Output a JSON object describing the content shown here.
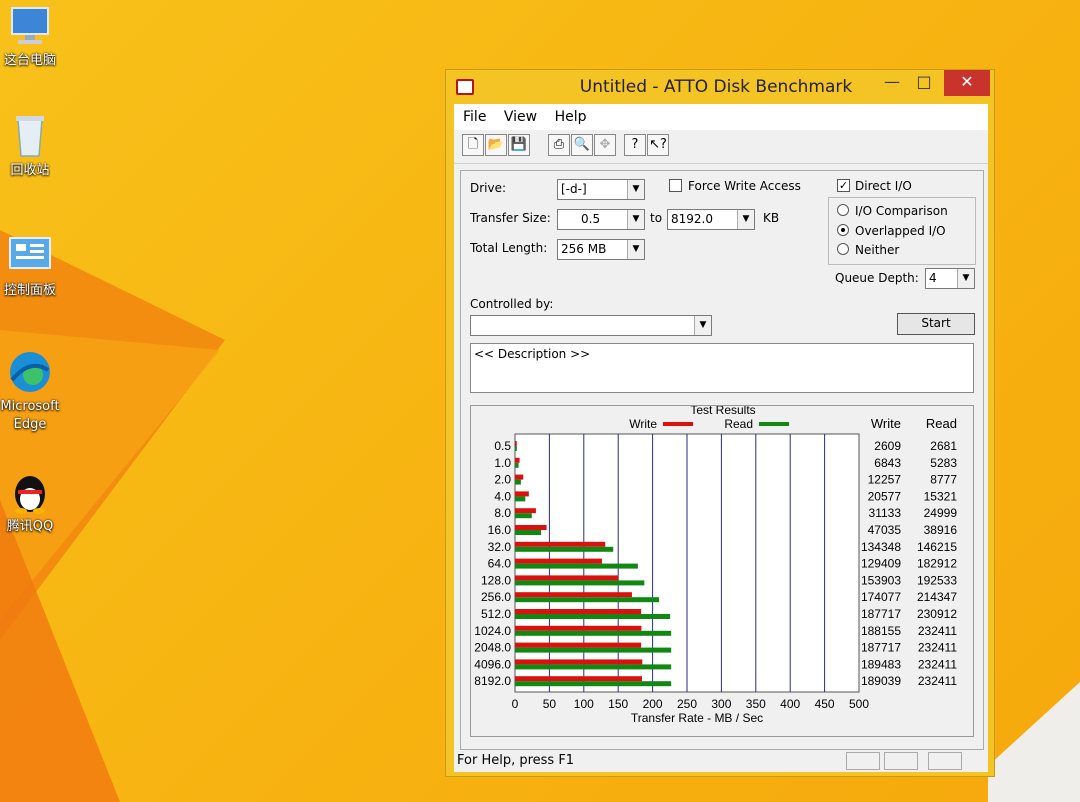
{
  "desktop": {
    "icons": [
      {
        "label": "这台电脑"
      },
      {
        "label": "回收站"
      },
      {
        "label": "控制面板"
      },
      {
        "label": "Microsoft Edge"
      },
      {
        "label": "腾讯QQ"
      }
    ]
  },
  "window": {
    "title": "Untitled - ATTO Disk Benchmark",
    "menu": [
      "File",
      "View",
      "Help"
    ],
    "toolbar_icons": [
      "new-icon",
      "open-icon",
      "save-icon",
      "print-icon",
      "print-preview-icon",
      "move-icon",
      "help-icon",
      "context-help-icon"
    ],
    "form": {
      "drive_label": "Drive:",
      "drive_value": "[-d-]",
      "transfer_label": "Transfer Size:",
      "transfer_from": "0.5",
      "transfer_to_label": "to",
      "transfer_to": "8192.0",
      "transfer_unit": "KB",
      "total_label": "Total Length:",
      "total_value": "256 MB",
      "force_write_label": "Force Write Access",
      "direct_io_label": "Direct I/O",
      "io_comparison_label": "I/O Comparison",
      "overlapped_label": "Overlapped I/O",
      "neither_label": "Neither",
      "queue_label": "Queue Depth:",
      "queue_value": "4",
      "controlled_label": "Controlled by:",
      "controlled_value": "",
      "start_label": "Start",
      "description": "<< Description >>"
    },
    "status": "For Help, press F1"
  },
  "chart_data": {
    "type": "bar",
    "title": "Test Results",
    "xlabel": "Transfer Rate - MB / Sec",
    "xlim": [
      0,
      500
    ],
    "x_ticks": [
      "0",
      "50",
      "100",
      "150",
      "200",
      "250",
      "300",
      "350",
      "400",
      "450",
      "500"
    ],
    "legend": {
      "write": "Write",
      "read": "Read"
    },
    "colors": {
      "write": "#dd1010",
      "read": "#118811"
    },
    "col_write": "Write",
    "col_read": "Read",
    "categories": [
      "0.5",
      "1.0",
      "2.0",
      "4.0",
      "8.0",
      "16.0",
      "32.0",
      "64.0",
      "128.0",
      "256.0",
      "512.0",
      "1024.0",
      "2048.0",
      "4096.0",
      "8192.0"
    ],
    "series": [
      {
        "name": "Write",
        "values": [
          2609,
          6843,
          12257,
          20577,
          31133,
          47035,
          134348,
          129409,
          153903,
          174077,
          187717,
          188155,
          187717,
          189483,
          189039
        ]
      },
      {
        "name": "Read",
        "values": [
          2681,
          5283,
          8777,
          15321,
          24999,
          38916,
          146215,
          182912,
          192533,
          214347,
          230912,
          232411,
          232411,
          232411,
          232411
        ]
      }
    ]
  }
}
